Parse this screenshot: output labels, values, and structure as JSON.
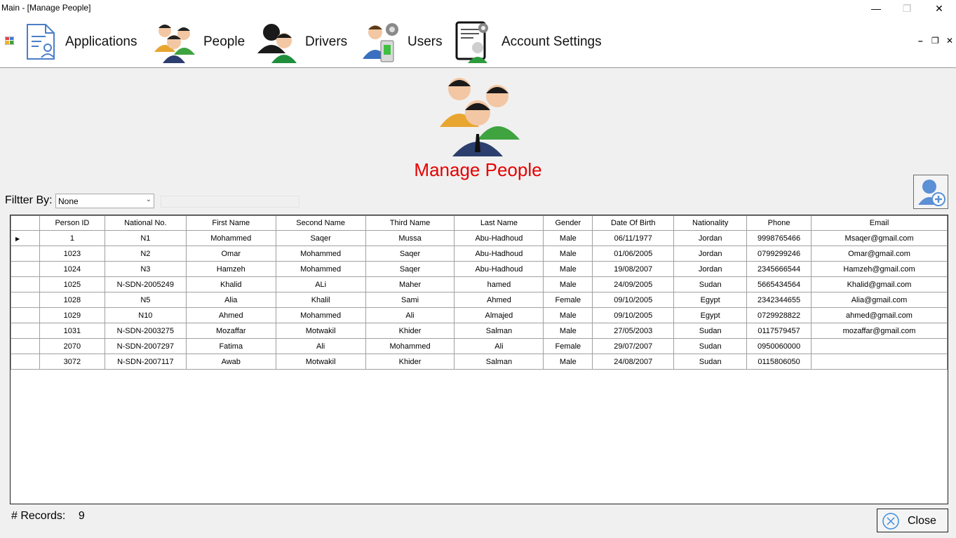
{
  "window": {
    "title": "Main - [Manage People]"
  },
  "menu": {
    "items": [
      {
        "label": "Applications",
        "icon": "applications-icon"
      },
      {
        "label": "People",
        "icon": "people-icon"
      },
      {
        "label": "Drivers",
        "icon": "drivers-icon"
      },
      {
        "label": "Users",
        "icon": "users-icon"
      },
      {
        "label": "Account Settings",
        "icon": "account-settings-icon"
      }
    ]
  },
  "page": {
    "title": "Manage People",
    "title_color": "#e60000"
  },
  "filter": {
    "label": "Filtter By:",
    "selected": "None",
    "text_value": ""
  },
  "grid": {
    "columns": [
      "Person ID",
      "National No.",
      "First Name",
      "Second Name",
      "Third Name",
      "Last Name",
      "Gender",
      "Date Of Birth",
      "Nationality",
      "Phone",
      "Email"
    ],
    "rows": [
      [
        "1",
        "N1",
        "Mohammed",
        "Saqer",
        "Mussa",
        "Abu-Hadhoud",
        "Male",
        "06/11/1977",
        "Jordan",
        "9998765466",
        "Msaqer@gmail.com"
      ],
      [
        "1023",
        "N2",
        "Omar",
        "Mohammed",
        "Saqer",
        "Abu-Hadhoud",
        "Male",
        "01/06/2005",
        "Jordan",
        "0799299246",
        "Omar@gmail.com"
      ],
      [
        "1024",
        "N3",
        "Hamzeh",
        "Mohammed",
        "Saqer",
        "Abu-Hadhoud",
        "Male",
        "19/08/2007",
        "Jordan",
        "2345666544",
        "Hamzeh@gmail.com"
      ],
      [
        "1025",
        "N-SDN-2005249",
        "Khalid",
        "ALi",
        "Maher",
        "hamed",
        "Male",
        "24/09/2005",
        "Sudan",
        "5665434564",
        "Khalid@gmail.com"
      ],
      [
        "1028",
        "N5",
        "Alia",
        "Khalil",
        "Sami",
        "Ahmed",
        "Female",
        "09/10/2005",
        "Egypt",
        "2342344655",
        "Alia@gmail.com"
      ],
      [
        "1029",
        "N10",
        "Ahmed",
        "Mohammed",
        "Ali",
        "Almajed",
        "Male",
        "09/10/2005",
        "Egypt",
        "0729928822",
        "ahmed@gmail.com"
      ],
      [
        "1031",
        "N-SDN-2003275",
        "Mozaffar",
        "Motwakil",
        "Khider",
        "Salman",
        "Male",
        "27/05/2003",
        "Sudan",
        "0117579457",
        "mozaffar@gmail.com"
      ],
      [
        "2070",
        "N-SDN-2007297",
        "Fatima",
        "Ali",
        "Mohammed",
        "Ali",
        "Female",
        "29/07/2007",
        "Sudan",
        "0950060000",
        ""
      ],
      [
        "3072",
        "N-SDN-2007117",
        "Awab",
        "Motwakil",
        "Khider",
        "Salman",
        "Male",
        "24/08/2007",
        "Sudan",
        "0115806050",
        ""
      ]
    ]
  },
  "footer": {
    "records_label": "# Records:",
    "records_count": "9",
    "close_label": "Close"
  }
}
